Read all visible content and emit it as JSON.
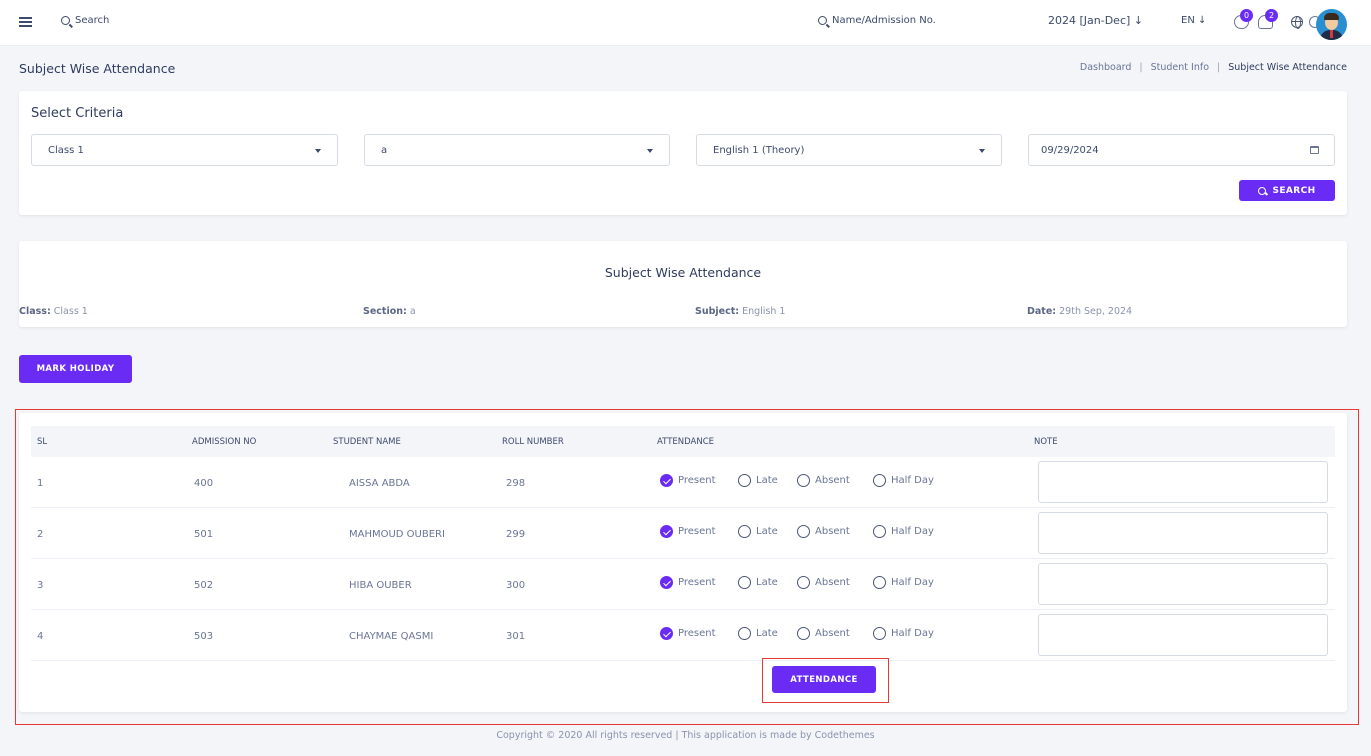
{
  "topbar": {
    "search_label": "Search",
    "student_search_placeholder": "Name/Admission No.",
    "session": "2024 [Jan-Dec] ↓",
    "language": "EN ↓",
    "message_count": "0",
    "notification_count": "2"
  },
  "page": {
    "title": "Subject Wise Attendance",
    "breadcrumb": [
      "Dashboard",
      "Student Info",
      "Subject Wise Attendance"
    ]
  },
  "criteria": {
    "title": "Select Criteria",
    "class_value": "Class 1",
    "section_value": "a",
    "subject_value": "English 1 (Theory)",
    "date_value": "09/29/2024",
    "search_button": "SEARCH"
  },
  "summary": {
    "title": "Subject Wise Attendance",
    "class_label": "Class:",
    "class_value": "Class 1",
    "section_label": "Section:",
    "section_value": "a",
    "subject_label": "Subject:",
    "subject_value": "English 1",
    "date_label": "Date:",
    "date_value": "29th Sep, 2024"
  },
  "mark_holiday_button": "MARK HOLIDAY",
  "table": {
    "headers": [
      "SL",
      "ADMISSION NO",
      "STUDENT NAME",
      "ROLL NUMBER",
      "ATTENDANCE",
      "NOTE"
    ],
    "attendance_options": [
      "Present",
      "Late",
      "Absent",
      "Half Day"
    ],
    "rows": [
      {
        "sl": "1",
        "admission": "400",
        "name": "AISSA ABDA",
        "roll": "298",
        "selected": "Present"
      },
      {
        "sl": "2",
        "admission": "501",
        "name": "MAHMOUD OUBERI",
        "roll": "299",
        "selected": "Present"
      },
      {
        "sl": "3",
        "admission": "502",
        "name": "HIBA OUBER",
        "roll": "300",
        "selected": "Present"
      },
      {
        "sl": "4",
        "admission": "503",
        "name": "CHAYMAE QASMI",
        "roll": "301",
        "selected": "Present"
      }
    ],
    "submit_button": "ATTENDANCE"
  },
  "footer": "Copyright © 2020 All rights reserved | This application is made by Codethemes",
  "colors": {
    "accent": "#6a2cf5",
    "highlight": "#e53935",
    "text": "#3d4a6b"
  }
}
